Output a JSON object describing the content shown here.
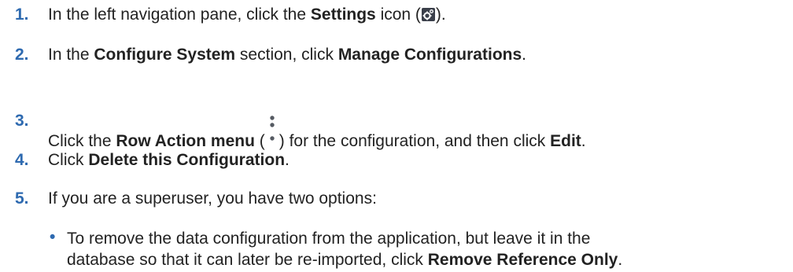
{
  "steps": [
    {
      "number": "1.",
      "parts": {
        "a": "In the left navigation pane, click the ",
        "b": "Settings",
        "c": " icon (",
        "d": ")."
      },
      "icon": "settings-gear-icon"
    },
    {
      "number": "2.",
      "parts": {
        "a": "In the ",
        "b": "Configure System",
        "c": " section, click ",
        "d": "Manage Configurations",
        "e": "."
      }
    },
    {
      "number": "3.",
      "parts": {
        "a": "Click the ",
        "b": "Row Action menu",
        "c": " (",
        "d": ") for the configuration, and then click ",
        "e": "Edit",
        "f": "."
      },
      "icon": "row-action-kebab-icon"
    },
    {
      "number": "4.",
      "parts": {
        "a": "Click ",
        "b": "Delete this Configuration",
        "c": "."
      }
    },
    {
      "number": "5.",
      "parts": {
        "a": "If you are a superuser, you have two options:"
      }
    }
  ],
  "sub_bullets": [
    {
      "line1": "To remove the data configuration from the application, but leave it in the",
      "line2a": "database so that it can later be re-imported, click ",
      "line2b": "Remove Reference Only",
      "line2c": "."
    }
  ],
  "colors": {
    "step_number": "#2e6ab0",
    "text": "#222222",
    "icon_bg": "#3a3f4a"
  }
}
